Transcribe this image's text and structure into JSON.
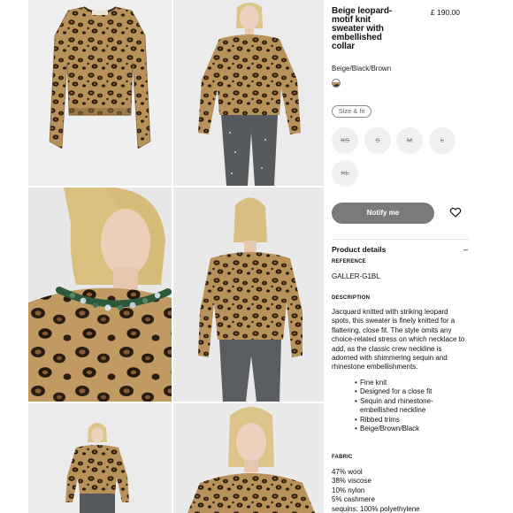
{
  "product": {
    "title": "Beige leopard-motif knit sweater with embellished collar",
    "price": "£ 190.00",
    "color": "Beige/Black/Brown"
  },
  "size_fit_label": "Size & fit",
  "sizes": [
    "XS",
    "S",
    "M",
    "L",
    "XL"
  ],
  "notify_label": "Notify me",
  "details": {
    "section_title": "Product details",
    "toggle": "–",
    "reference_label": "REFERENCE",
    "reference": "GALLER-G1BL",
    "description_label": "DESCRIPTION",
    "description": "Jacquard knitted with striking leopard spots, this sweater is finely knitted for a flattering, close fit. The style omits any choice-related stress on which necklace to add, as the classic crew neckline is adorned with shimmering sequin and rhinestone embellishments.",
    "bullets": [
      "Fine knit",
      "Designed for a close fit",
      "Sequin and rhinestone-embellished neckline",
      "Ribbed trims",
      "Beige/Brown/Black"
    ],
    "fabric_label": "FABRIC",
    "fabric": [
      "47% wool",
      "38% viscose",
      "10% nylon",
      "5% cashmere",
      "sequins: 100% polyethylene"
    ]
  },
  "icons": {
    "wishlist": "heart-icon"
  },
  "colors": {
    "notify_button": "#7a7a7a",
    "size_chip": "#f0f0f0"
  }
}
